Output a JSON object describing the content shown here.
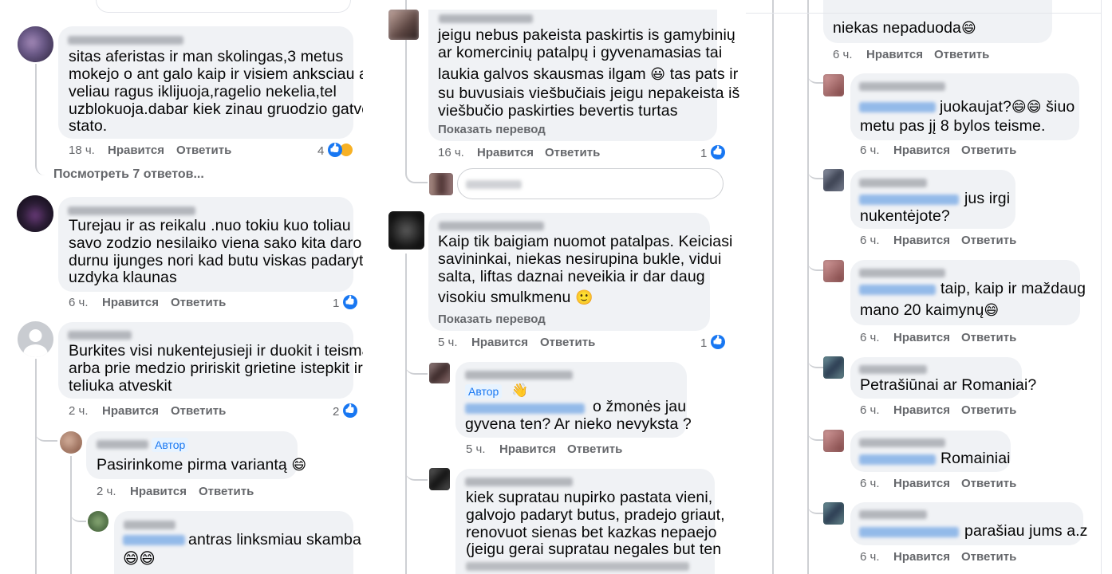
{
  "col1": {
    "c1": {
      "lines": [
        "sitas aferistas ir man skolingas,3 metus",
        "mokejo o ant galo kaip ir visiem anksciau ar",
        "veliau ragus iklijuoja,ragelio nekelia,tel",
        "uzblokuoja.dabar kiek zinau gruodzio gatvej",
        "stato."
      ],
      "time": "18 ч.",
      "like": "Нравится",
      "reply": "Ответить",
      "count": "4"
    },
    "more": "Посмотреть 7 ответов...",
    "c2": {
      "lines": [
        "Turejau ir as reikalu .nuo tokiu kuo toliau",
        "savo zodzio nesilaiko viena sako kita daro",
        "durnu ijunges nori kad butu viskas padaryta",
        "uzdyka klaunas"
      ],
      "time": "6 ч.",
      "like": "Нравится",
      "reply": "Ответить",
      "count": "1"
    },
    "c3": {
      "lines": [
        "Burkites visi nukentejusieji ir duokit i teisma,",
        "arba prie medzio pririskit grietine istepkit ir",
        "teliuka atveskit"
      ],
      "time": "2 ч.",
      "like": "Нравится",
      "reply": "Ответить",
      "count": "2"
    },
    "c4": {
      "badge": "Автор",
      "text": "Pasirinkome pirma variantą",
      "emoji": "😄",
      "time": "2 ч.",
      "like": "Нравится",
      "reply": "Ответить"
    },
    "c5": {
      "text": "antras linksmiau skamba",
      "emoji": "😄😄"
    }
  },
  "col2": {
    "c1": {
      "lines": [
        "jeigu nebus pakeista paskirtis is gamybinių",
        "ar komercinių patalpų i gyvenamasias tai",
        "laukia galvos skausmas ilgam",
        "su buvusiais viešbučiais jeigu nepakeista iš",
        "viešbučio paskirties bevertis turtas"
      ],
      "line3_emoji": "😃",
      "line3_tail": "tas pats ir",
      "translate": "Показать перевод",
      "time": "16 ч.",
      "like": "Нравится",
      "reply": "Ответить",
      "count": "1"
    },
    "c2": {
      "lines": [
        "Kaip tik baigiam nuomot patalpas. Keiciasi",
        "savininkai, niekas nesirupina bukle, vidui",
        "salta, liftas daznai neveikia ir dar daug",
        "visokiu smulkmenu"
      ],
      "emoji": "🙂",
      "translate": "Показать перевод",
      "time": "5 ч.",
      "like": "Нравится",
      "reply": "Ответить",
      "count": "1"
    },
    "c3": {
      "badge": "Автор",
      "wave": "👋",
      "line1": "o žmonės jau",
      "line2": "gyvena ten? Ar nieko nevyksta ?",
      "time": "5 ч.",
      "like": "Нравится",
      "reply": "Ответить"
    },
    "c4": {
      "lines": [
        "kiek supratau nupirko pastata vieni,",
        "galvojo padaryt butus, pradejo griaut,",
        "renovuot sienas bet kazkas nepaejo",
        "(jeigu gerai supratau negales but ten"
      ]
    }
  },
  "col3": {
    "c0": {
      "text": "niekas nepaduoda",
      "emoji": "😄",
      "time": "6 ч.",
      "like": "Нравится",
      "reply": "Ответить"
    },
    "c1": {
      "tail": "juokaujat?",
      "emoji": "😄😄",
      "tail2": "šiuo",
      "line2": "metu pas jį 8 bylos teisme.",
      "time": "6 ч.",
      "like": "Нравится",
      "reply": "Ответить"
    },
    "c2": {
      "tail": "jus irgi",
      "line2": "nukentėjote?",
      "time": "6 ч.",
      "like": "Нравится",
      "reply": "Ответить"
    },
    "c3": {
      "tail": "taip, kaip ir maždaug",
      "line2": "mano 20 kaimynų",
      "emoji": "😄",
      "time": "6 ч.",
      "like": "Нравится",
      "reply": "Ответить"
    },
    "c4": {
      "text": "Petrašiūnai ar Romaniai?",
      "time": "6 ч.",
      "like": "Нравится",
      "reply": "Ответить"
    },
    "c5": {
      "tail": "Romainiai",
      "time": "6 ч.",
      "like": "Нравится",
      "reply": "Ответить"
    },
    "c6": {
      "tail": "parašiau jums a.z",
      "time": "6 ч.",
      "like": "Нравится",
      "reply": "Ответить"
    }
  }
}
